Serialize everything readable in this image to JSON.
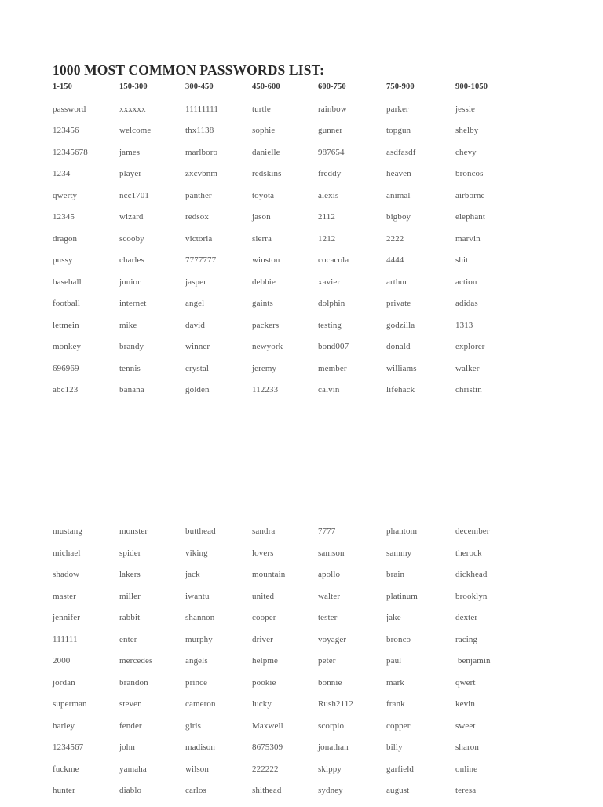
{
  "document": {
    "title": "1000 MOST COMMON PASSWORDS LIST:"
  },
  "table": {
    "headers": [
      "1-150",
      "150-300",
      "300-450",
      "450-600",
      "600-750",
      "750-900",
      "900-1050"
    ],
    "blocks": [
      {
        "name": "block-1",
        "has_headers": true,
        "rows": [
          [
            "password",
            "xxxxxx",
            "11111111",
            "turtle",
            "rainbow",
            "parker",
            "jessie"
          ],
          [
            "123456",
            "welcome",
            "thx1138",
            "sophie",
            "gunner",
            "topgun",
            "shelby"
          ],
          [
            "12345678",
            "james",
            "marlboro",
            "danielle",
            "987654",
            "asdfasdf",
            "chevy"
          ],
          [
            "1234",
            "player",
            "zxcvbnm",
            "redskins",
            "freddy",
            "heaven",
            "broncos"
          ],
          [
            "qwerty",
            "ncc1701",
            "panther",
            "toyota",
            "alexis",
            "animal",
            "airborne"
          ],
          [
            "12345",
            "wizard",
            "redsox",
            "jason",
            "2112",
            "bigboy",
            "elephant"
          ],
          [
            "dragon",
            "scooby",
            "victoria",
            "sierra",
            "1212",
            "2222",
            "marvin"
          ],
          [
            "pussy",
            "charles",
            "7777777",
            "winston",
            "cocacola",
            "4444",
            "shit"
          ],
          [
            "baseball",
            "junior",
            "jasper",
            "debbie",
            "xavier",
            "arthur",
            "action"
          ],
          [
            "football",
            "internet",
            "angel",
            "gaints",
            "dolphin",
            "private",
            "adidas"
          ],
          [
            "letmein",
            "mike",
            "david",
            "packers",
            "testing",
            "godzilla",
            "1313"
          ],
          [
            "monkey",
            "brandy",
            "winner",
            "newyork",
            "bond007",
            "donald",
            "explorer"
          ],
          [
            "696969",
            "tennis",
            "crystal",
            "jeremy",
            "member",
            "williams",
            "walker"
          ],
          [
            "abc123",
            "banana",
            "golden",
            "112233",
            "calvin",
            "lifehack",
            "christin"
          ]
        ]
      },
      {
        "name": "block-2",
        "has_headers": false,
        "rows": [
          [
            "mustang",
            "monster",
            "butthead",
            "sandra",
            "7777",
            "phantom",
            "december"
          ],
          [
            "michael",
            "spider",
            "viking",
            "lovers",
            "samson",
            "sammy",
            "therock"
          ],
          [
            "shadow",
            "lakers",
            "jack",
            "mountain",
            "apollo",
            "brain",
            "dickhead"
          ],
          [
            "master",
            "miller",
            "iwantu",
            "united",
            "walter",
            "platinum",
            "brooklyn"
          ],
          [
            "jennifer",
            "rabbit",
            "shannon",
            "cooper",
            "tester",
            "jake",
            "dexter"
          ],
          [
            "111111",
            "enter",
            "murphy",
            "driver",
            "voyager",
            "bronco",
            "racing"
          ],
          [
            "2000",
            "mercedes",
            "angels",
            "helpme",
            "peter",
            "paul",
            " benjamin"
          ],
          [
            "jordan",
            "brandon",
            "prince",
            "pookie",
            "bonnie",
            "mark",
            "qwert"
          ],
          [
            "superman",
            "steven",
            "cameron",
            "lucky",
            "Rush2112",
            "frank",
            "kevin"
          ],
          [
            "harley",
            "fender",
            "girls",
            "Maxwell",
            "scorpio",
            "copper",
            "sweet"
          ],
          [
            "1234567",
            "john",
            "madison",
            "8675309",
            "jonathan",
            "billy",
            "sharon"
          ],
          [
            "fuckme",
            "yamaha",
            "wilson",
            "222222",
            "skippy",
            "garfield",
            "online"
          ],
          [
            "hunter",
            "diablo",
            "carlos",
            "shithead",
            "sydney",
            "august",
            "teresa"
          ]
        ]
      }
    ]
  },
  "colors": {
    "page_background": "#ffffff",
    "title_text": "#2a2a2a",
    "header_text": "#3b3b3b",
    "cell_text": "#565656"
  }
}
